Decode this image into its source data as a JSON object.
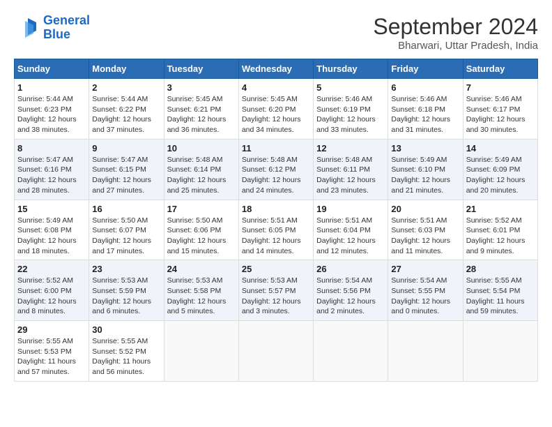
{
  "logo": {
    "line1": "General",
    "line2": "Blue"
  },
  "title": "September 2024",
  "subtitle": "Bharwari, Uttar Pradesh, India",
  "weekdays": [
    "Sunday",
    "Monday",
    "Tuesday",
    "Wednesday",
    "Thursday",
    "Friday",
    "Saturday"
  ],
  "weeks": [
    [
      {
        "day": "1",
        "detail": "Sunrise: 5:44 AM\nSunset: 6:23 PM\nDaylight: 12 hours\nand 38 minutes."
      },
      {
        "day": "2",
        "detail": "Sunrise: 5:44 AM\nSunset: 6:22 PM\nDaylight: 12 hours\nand 37 minutes."
      },
      {
        "day": "3",
        "detail": "Sunrise: 5:45 AM\nSunset: 6:21 PM\nDaylight: 12 hours\nand 36 minutes."
      },
      {
        "day": "4",
        "detail": "Sunrise: 5:45 AM\nSunset: 6:20 PM\nDaylight: 12 hours\nand 34 minutes."
      },
      {
        "day": "5",
        "detail": "Sunrise: 5:46 AM\nSunset: 6:19 PM\nDaylight: 12 hours\nand 33 minutes."
      },
      {
        "day": "6",
        "detail": "Sunrise: 5:46 AM\nSunset: 6:18 PM\nDaylight: 12 hours\nand 31 minutes."
      },
      {
        "day": "7",
        "detail": "Sunrise: 5:46 AM\nSunset: 6:17 PM\nDaylight: 12 hours\nand 30 minutes."
      }
    ],
    [
      {
        "day": "8",
        "detail": "Sunrise: 5:47 AM\nSunset: 6:16 PM\nDaylight: 12 hours\nand 28 minutes."
      },
      {
        "day": "9",
        "detail": "Sunrise: 5:47 AM\nSunset: 6:15 PM\nDaylight: 12 hours\nand 27 minutes."
      },
      {
        "day": "10",
        "detail": "Sunrise: 5:48 AM\nSunset: 6:14 PM\nDaylight: 12 hours\nand 25 minutes."
      },
      {
        "day": "11",
        "detail": "Sunrise: 5:48 AM\nSunset: 6:12 PM\nDaylight: 12 hours\nand 24 minutes."
      },
      {
        "day": "12",
        "detail": "Sunrise: 5:48 AM\nSunset: 6:11 PM\nDaylight: 12 hours\nand 23 minutes."
      },
      {
        "day": "13",
        "detail": "Sunrise: 5:49 AM\nSunset: 6:10 PM\nDaylight: 12 hours\nand 21 minutes."
      },
      {
        "day": "14",
        "detail": "Sunrise: 5:49 AM\nSunset: 6:09 PM\nDaylight: 12 hours\nand 20 minutes."
      }
    ],
    [
      {
        "day": "15",
        "detail": "Sunrise: 5:49 AM\nSunset: 6:08 PM\nDaylight: 12 hours\nand 18 minutes."
      },
      {
        "day": "16",
        "detail": "Sunrise: 5:50 AM\nSunset: 6:07 PM\nDaylight: 12 hours\nand 17 minutes."
      },
      {
        "day": "17",
        "detail": "Sunrise: 5:50 AM\nSunset: 6:06 PM\nDaylight: 12 hours\nand 15 minutes."
      },
      {
        "day": "18",
        "detail": "Sunrise: 5:51 AM\nSunset: 6:05 PM\nDaylight: 12 hours\nand 14 minutes."
      },
      {
        "day": "19",
        "detail": "Sunrise: 5:51 AM\nSunset: 6:04 PM\nDaylight: 12 hours\nand 12 minutes."
      },
      {
        "day": "20",
        "detail": "Sunrise: 5:51 AM\nSunset: 6:03 PM\nDaylight: 12 hours\nand 11 minutes."
      },
      {
        "day": "21",
        "detail": "Sunrise: 5:52 AM\nSunset: 6:01 PM\nDaylight: 12 hours\nand 9 minutes."
      }
    ],
    [
      {
        "day": "22",
        "detail": "Sunrise: 5:52 AM\nSunset: 6:00 PM\nDaylight: 12 hours\nand 8 minutes."
      },
      {
        "day": "23",
        "detail": "Sunrise: 5:53 AM\nSunset: 5:59 PM\nDaylight: 12 hours\nand 6 minutes."
      },
      {
        "day": "24",
        "detail": "Sunrise: 5:53 AM\nSunset: 5:58 PM\nDaylight: 12 hours\nand 5 minutes."
      },
      {
        "day": "25",
        "detail": "Sunrise: 5:53 AM\nSunset: 5:57 PM\nDaylight: 12 hours\nand 3 minutes."
      },
      {
        "day": "26",
        "detail": "Sunrise: 5:54 AM\nSunset: 5:56 PM\nDaylight: 12 hours\nand 2 minutes."
      },
      {
        "day": "27",
        "detail": "Sunrise: 5:54 AM\nSunset: 5:55 PM\nDaylight: 12 hours\nand 0 minutes."
      },
      {
        "day": "28",
        "detail": "Sunrise: 5:55 AM\nSunset: 5:54 PM\nDaylight: 11 hours\nand 59 minutes."
      }
    ],
    [
      {
        "day": "29",
        "detail": "Sunrise: 5:55 AM\nSunset: 5:53 PM\nDaylight: 11 hours\nand 57 minutes."
      },
      {
        "day": "30",
        "detail": "Sunrise: 5:55 AM\nSunset: 5:52 PM\nDaylight: 11 hours\nand 56 minutes."
      },
      {
        "day": "",
        "detail": ""
      },
      {
        "day": "",
        "detail": ""
      },
      {
        "day": "",
        "detail": ""
      },
      {
        "day": "",
        "detail": ""
      },
      {
        "day": "",
        "detail": ""
      }
    ]
  ]
}
